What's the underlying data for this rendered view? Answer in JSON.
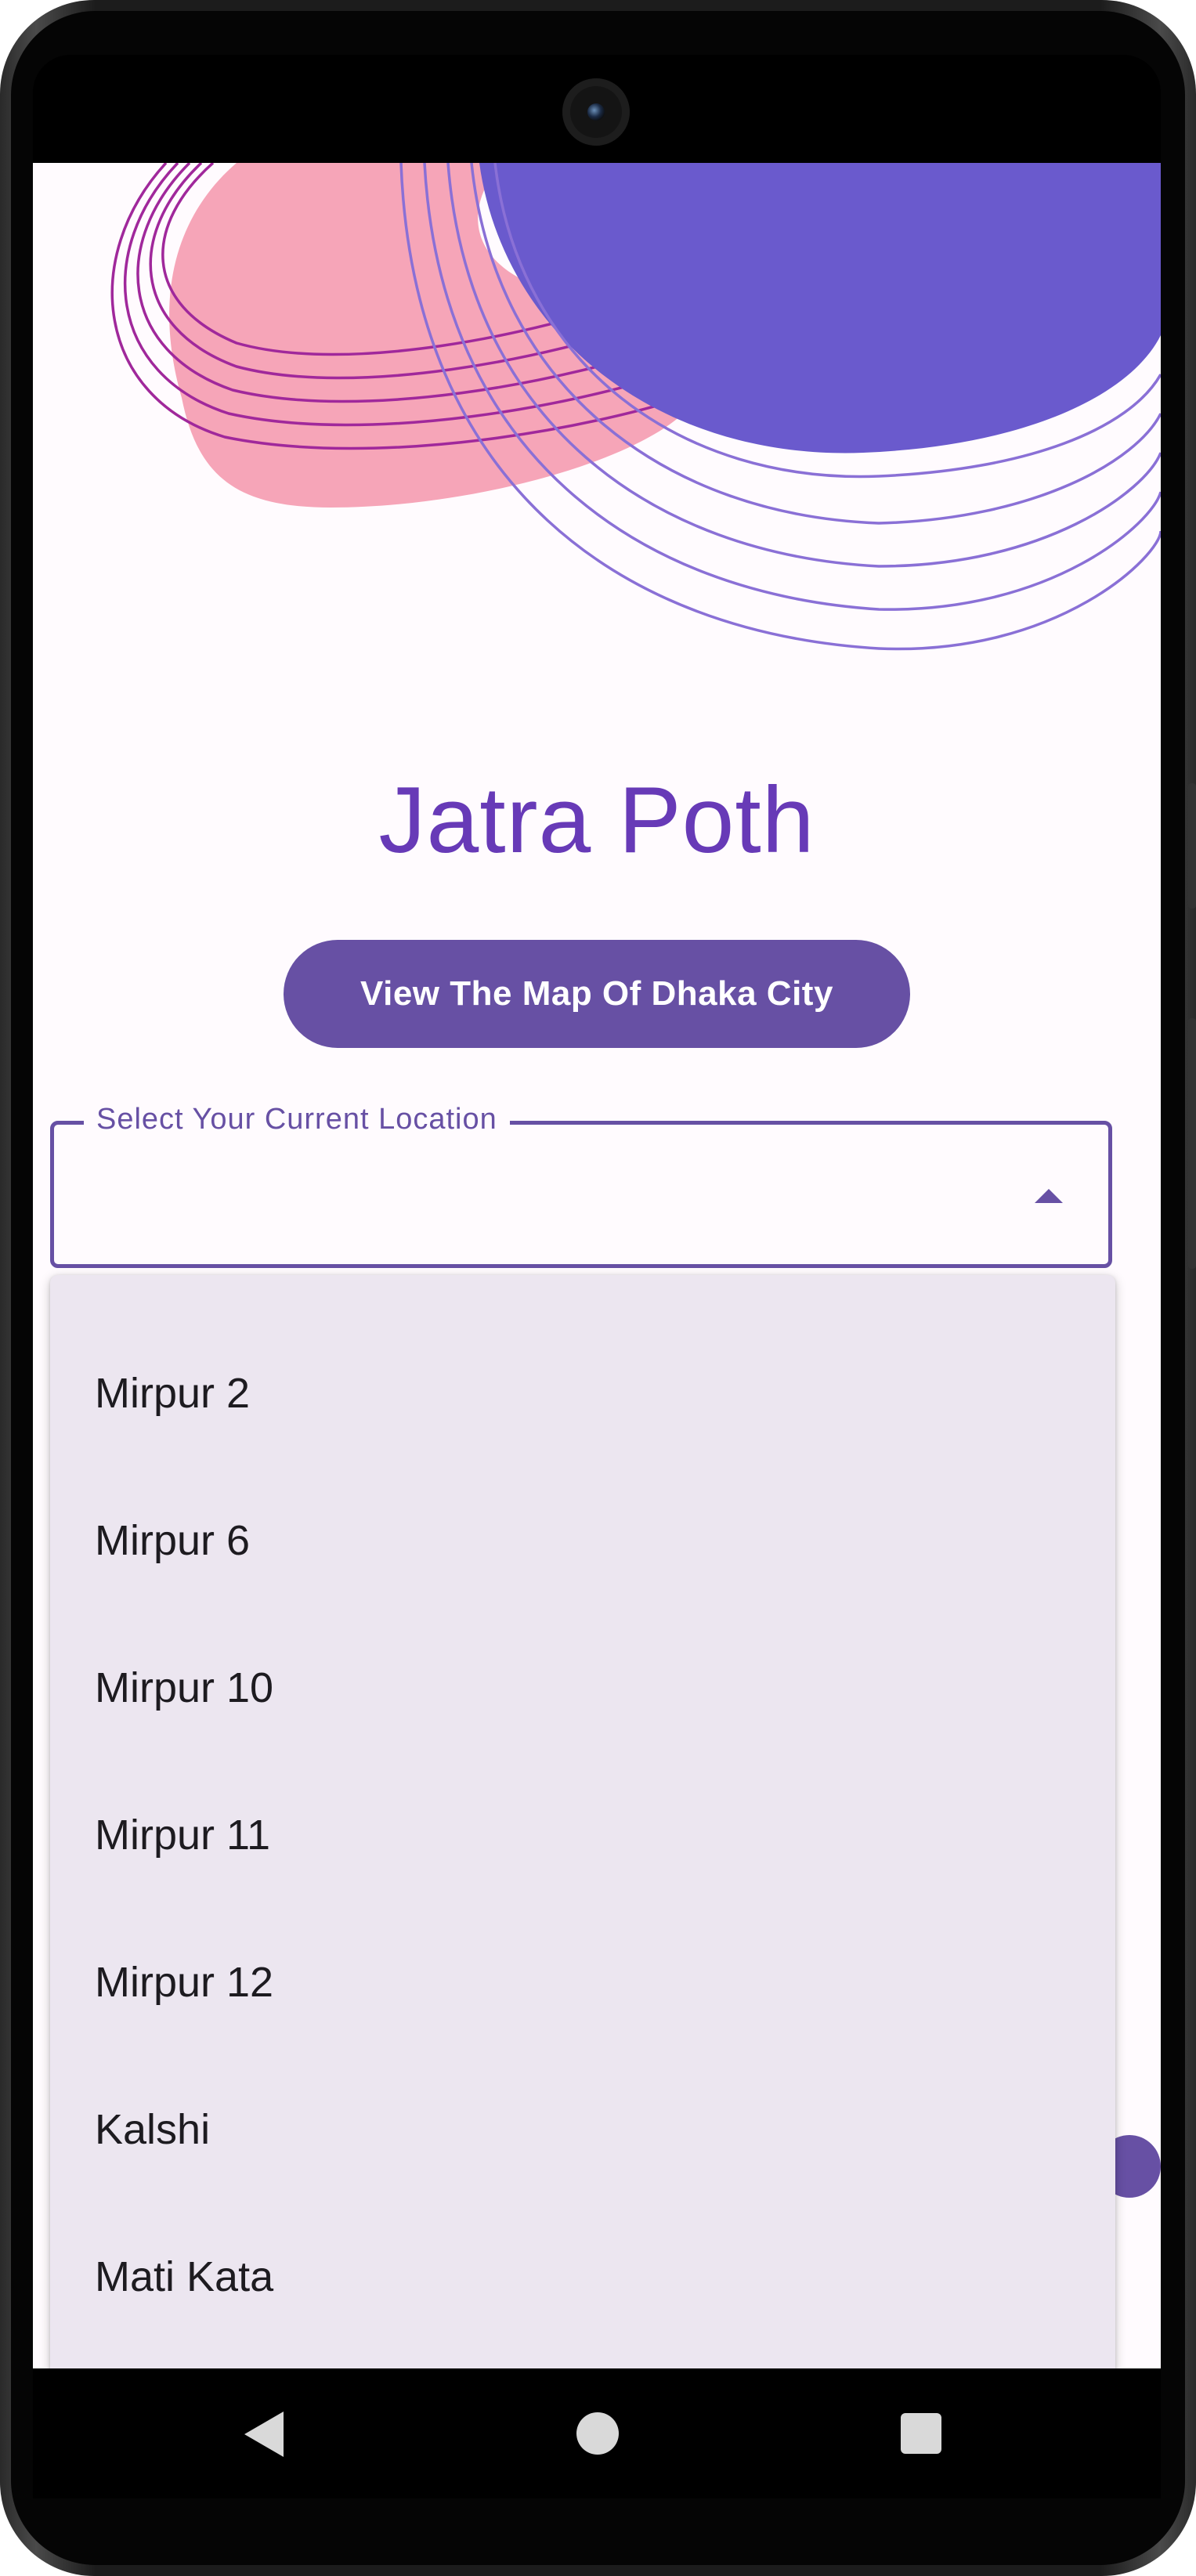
{
  "app": {
    "title": "Jatra Poth",
    "map_button_label": "View The Map Of Dhaka City",
    "accent_color": "#673ab7",
    "button_color": "#6750a4"
  },
  "location_dropdown": {
    "label": "Select Your Current Location",
    "selected_value": "",
    "expanded": true,
    "options": [
      "Mirpur 2",
      "Mirpur 6",
      "Mirpur 10",
      "Mirpur 11",
      "Mirpur 12",
      "Kalshi",
      "Mati Kata"
    ]
  },
  "decoration": {
    "pink_blob_color": "#f6a5b8",
    "purple_circle_color": "#6a5acd",
    "magenta_line_color": "#a0289b",
    "violet_line_color": "#8a70d6"
  },
  "nav_bar": {
    "back_icon": "back-triangle-icon",
    "home_icon": "home-circle-icon",
    "recents_icon": "recents-square-icon"
  }
}
